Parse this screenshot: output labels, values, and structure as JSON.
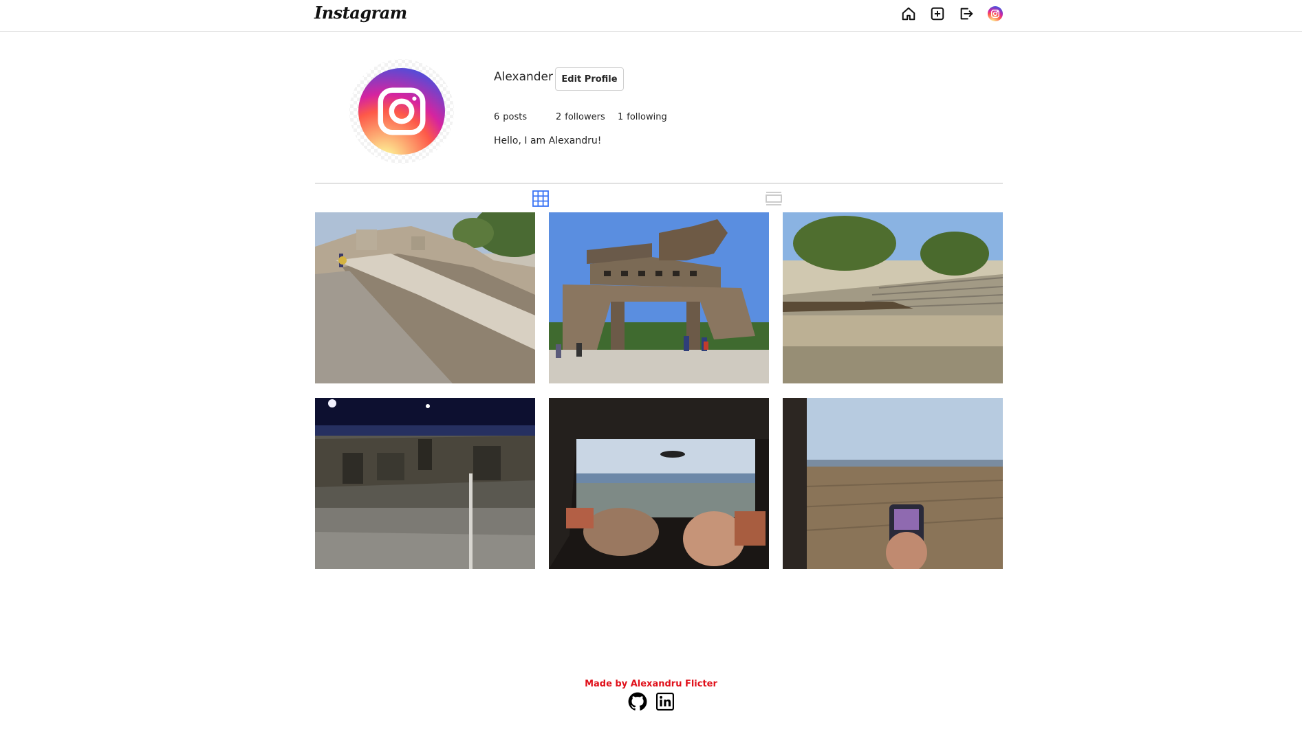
{
  "header": {
    "logo_text": "Instagram",
    "icons": [
      "home-icon",
      "new-post-icon",
      "logout-icon",
      "profile-avatar-icon"
    ]
  },
  "profile": {
    "username": "Alexander",
    "edit_button_label": "Edit Profile",
    "posts_count": "6",
    "posts_label": "posts",
    "followers_count": "2",
    "followers_label": "followers",
    "following_count": "1",
    "following_label": "following",
    "bio": "Hello, I am Alexandru!"
  },
  "tabs": {
    "active": "grid",
    "items": [
      "grid-view-icon",
      "feed-view-icon"
    ],
    "active_color": "#3b74f5",
    "inactive_color": "#c7c7c7"
  },
  "posts": [
    {
      "scene": "ancient-ruins-street"
    },
    {
      "scene": "trojan-horse"
    },
    {
      "scene": "ancient-theater"
    },
    {
      "scene": "night-ruins"
    },
    {
      "scene": "bus-window-view"
    },
    {
      "scene": "field-through-window"
    }
  ],
  "footer": {
    "credit": "Made by Alexandru Flicter",
    "credit_color": "#e0101a",
    "links": [
      "github-icon",
      "linkedin-icon"
    ]
  }
}
